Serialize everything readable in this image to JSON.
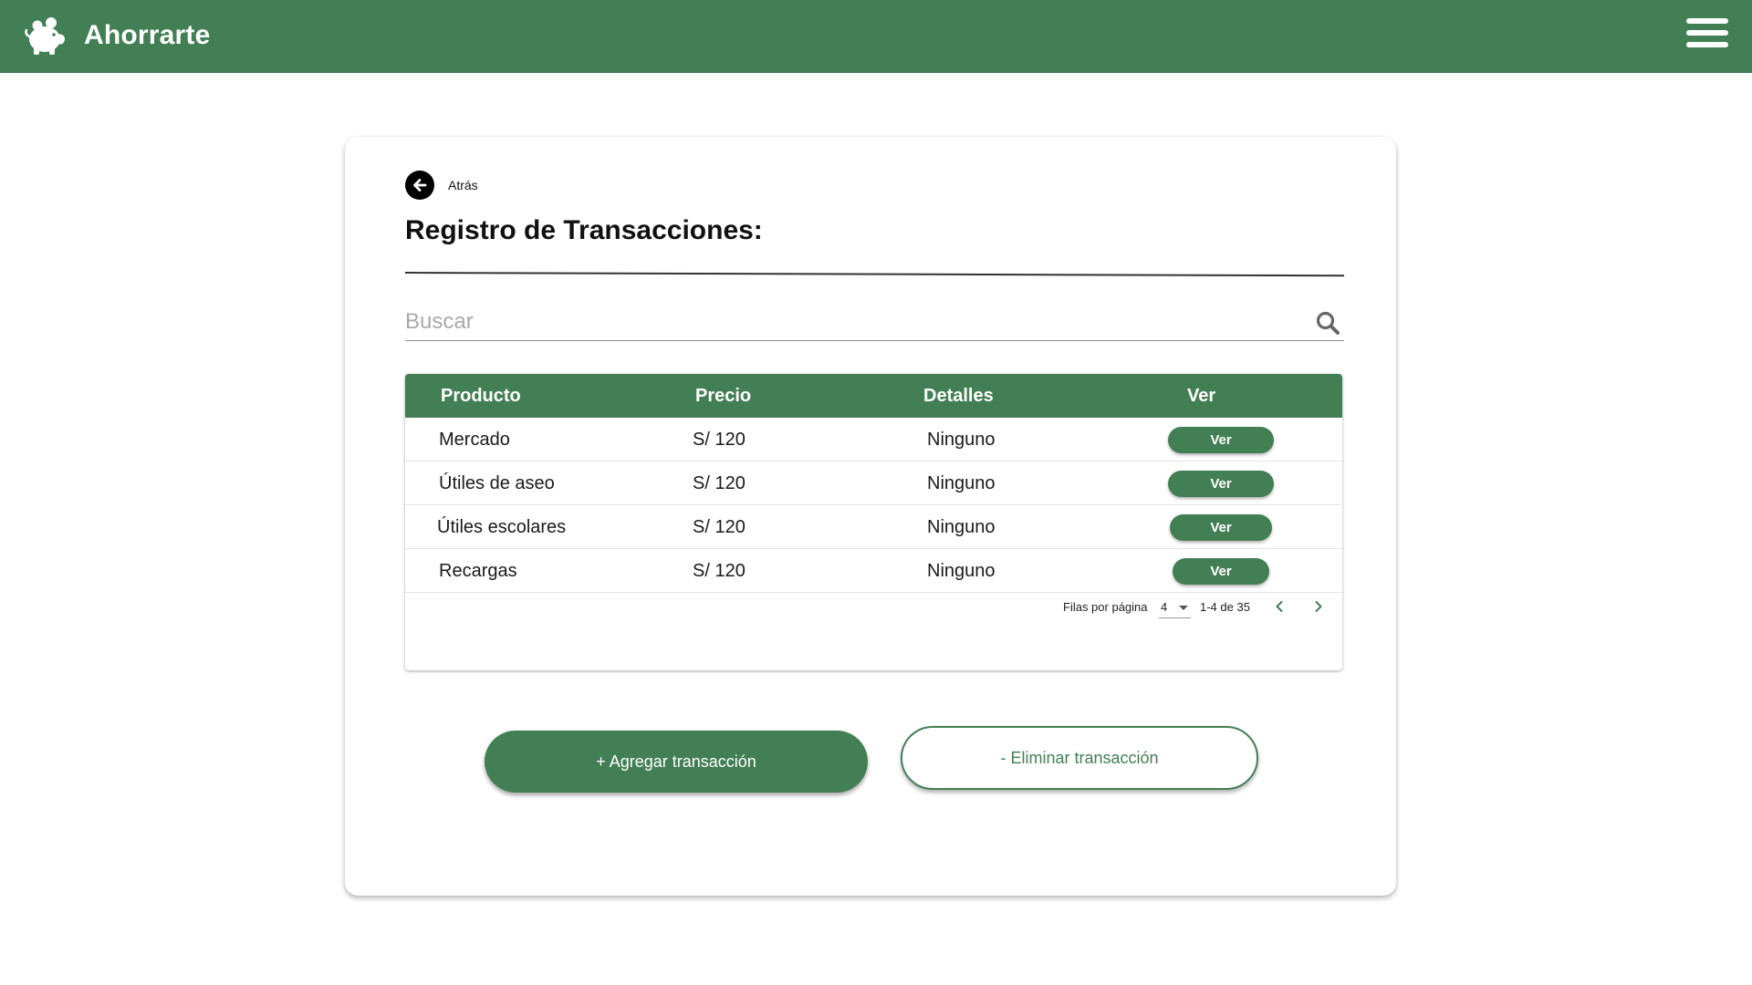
{
  "app": {
    "name": "Ahorrarte"
  },
  "colors": {
    "primary": "#437f55",
    "background": "#ffffff",
    "text": "#111111"
  },
  "icons": {
    "logo": "piggy-bank-icon",
    "menu": "hamburger-menu-icon",
    "back": "arrow-left-icon",
    "search": "search-icon",
    "prev": "chevron-left-icon",
    "next": "chevron-right-icon"
  },
  "back": {
    "label": "Atrás"
  },
  "page": {
    "title": "Registro de Transacciones:"
  },
  "search": {
    "placeholder": "Buscar"
  },
  "table": {
    "headers": {
      "producto": "Producto",
      "precio": "Precio",
      "detalles": "Detalles",
      "ver": "Ver"
    },
    "rows": [
      {
        "producto": "Mercado",
        "precio": "S/ 120",
        "detalles": "Ninguno",
        "ver": "Ver"
      },
      {
        "producto": "Útiles de aseo",
        "precio": "S/ 120",
        "detalles": "Ninguno",
        "ver": "Ver"
      },
      {
        "producto": "Útiles escolares",
        "precio": "S/ 120",
        "detalles": "Ninguno",
        "ver": "Ver"
      },
      {
        "producto": "Recargas",
        "precio": "S/ 120",
        "detalles": "Ninguno",
        "ver": "Ver"
      }
    ]
  },
  "pagination": {
    "rows_label": "Filas por página",
    "rows_value": "4",
    "range": "1-4 de 35"
  },
  "actions": {
    "add": "+  Agregar  transacción",
    "remove": "-  Eliminar transacción"
  }
}
